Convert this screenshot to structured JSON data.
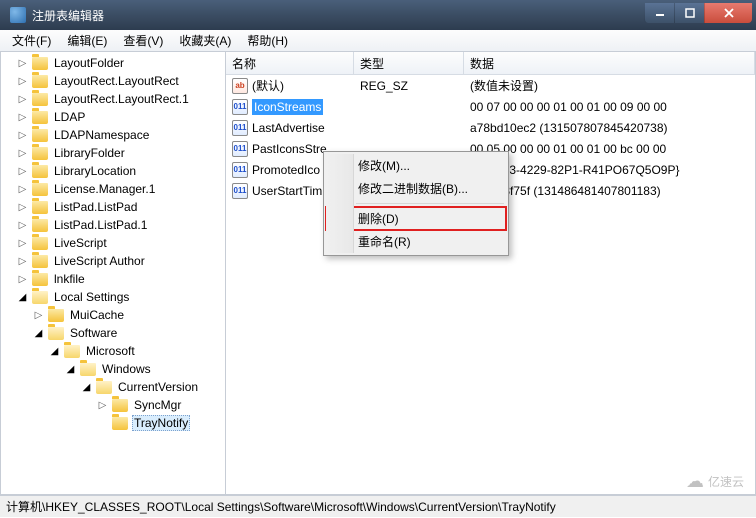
{
  "window": {
    "title": "注册表编辑器"
  },
  "menubar": [
    "文件(F)",
    "编辑(E)",
    "查看(V)",
    "收藏夹(A)",
    "帮助(H)"
  ],
  "tree": [
    {
      "indent": 1,
      "toggle": "closed",
      "label": "LayoutFolder"
    },
    {
      "indent": 1,
      "toggle": "closed",
      "label": "LayoutRect.LayoutRect"
    },
    {
      "indent": 1,
      "toggle": "closed",
      "label": "LayoutRect.LayoutRect.1"
    },
    {
      "indent": 1,
      "toggle": "closed",
      "label": "LDAP"
    },
    {
      "indent": 1,
      "toggle": "closed",
      "label": "LDAPNamespace"
    },
    {
      "indent": 1,
      "toggle": "closed",
      "label": "LibraryFolder"
    },
    {
      "indent": 1,
      "toggle": "closed",
      "label": "LibraryLocation"
    },
    {
      "indent": 1,
      "toggle": "closed",
      "label": "License.Manager.1"
    },
    {
      "indent": 1,
      "toggle": "closed",
      "label": "ListPad.ListPad"
    },
    {
      "indent": 1,
      "toggle": "closed",
      "label": "ListPad.ListPad.1"
    },
    {
      "indent": 1,
      "toggle": "closed",
      "label": "LiveScript"
    },
    {
      "indent": 1,
      "toggle": "closed",
      "label": "LiveScript Author"
    },
    {
      "indent": 1,
      "toggle": "closed",
      "label": "lnkfile"
    },
    {
      "indent": 1,
      "toggle": "open",
      "label": "Local Settings"
    },
    {
      "indent": 2,
      "toggle": "closed",
      "label": "MuiCache"
    },
    {
      "indent": 2,
      "toggle": "open",
      "label": "Software"
    },
    {
      "indent": 3,
      "toggle": "open",
      "label": "Microsoft"
    },
    {
      "indent": 4,
      "toggle": "open",
      "label": "Windows"
    },
    {
      "indent": 5,
      "toggle": "open",
      "label": "CurrentVersion"
    },
    {
      "indent": 6,
      "toggle": "closed",
      "label": "SyncMgr"
    },
    {
      "indent": 6,
      "toggle": "none",
      "label": "TrayNotify",
      "selected": true
    }
  ],
  "columns": {
    "name": "名称",
    "type": "类型",
    "data": "数据"
  },
  "values": [
    {
      "icon": "str",
      "name": "(默认)",
      "type": "REG_SZ",
      "data": "(数值未设置)"
    },
    {
      "icon": "bin",
      "name": "IconStreams",
      "type": "",
      "data": "00 07 00 00 00 01 00 01 00 09 00 00",
      "selected": true
    },
    {
      "icon": "bin",
      "name": "LastAdvertise",
      "type": "",
      "data": "a78bd10ec2 (1315078078454207​38)"
    },
    {
      "icon": "bin",
      "name": "PastIconsStre",
      "type": "",
      "data": "00 05 00 00 00 01 00 01 00 bc 00 00"
    },
    {
      "icon": "bin",
      "name": "PromotedIco",
      "type": "",
      "data": "76-23R3-4229-82P1-R41PO67Q5O9P}"
    },
    {
      "icon": "bin",
      "name": "UserStartTim",
      "type": "",
      "data": "421913f75f (131486481407801183)"
    }
  ],
  "context_menu": {
    "items": [
      {
        "label": "修改(M)...",
        "type": "item"
      },
      {
        "label": "修改二进制数据(B)...",
        "type": "item"
      },
      {
        "type": "sep"
      },
      {
        "label": "删除(D)",
        "type": "item",
        "highlight": true
      },
      {
        "label": "重命名(R)",
        "type": "item"
      }
    ]
  },
  "statusbar": "计算机\\HKEY_CLASSES_ROOT\\Local Settings\\Software\\Microsoft\\Windows\\CurrentVersion\\TrayNotify",
  "watermark": "亿速云"
}
